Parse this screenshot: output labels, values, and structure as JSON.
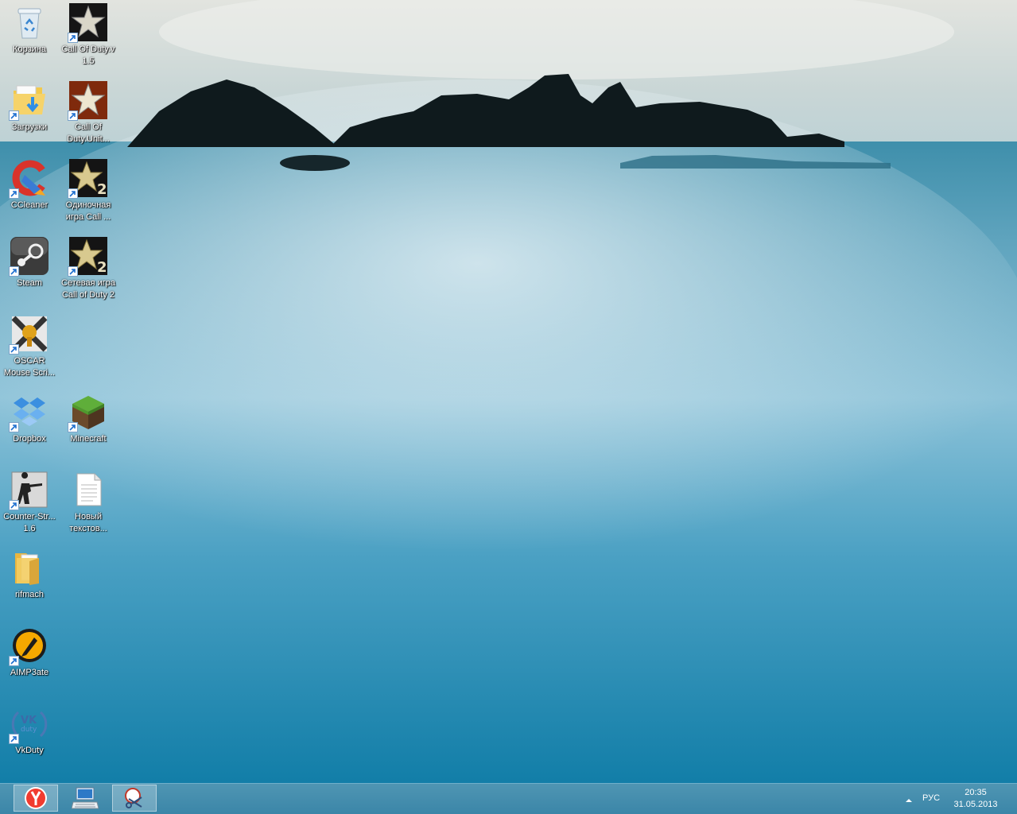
{
  "desktop": {
    "icons": [
      {
        "label": "Корзина",
        "icon": "recycle-bin-icon",
        "shortcut": false
      },
      {
        "label": "Call Of Duty.v 1.5",
        "icon": "call-of-duty-icon",
        "shortcut": true
      },
      {
        "label": "Загрузки",
        "icon": "downloads-folder-icon",
        "shortcut": true
      },
      {
        "label": "Call Of Duty.Unit...",
        "icon": "call-of-duty-united-offensive-icon",
        "shortcut": true
      },
      {
        "label": "CCleaner",
        "icon": "ccleaner-icon",
        "shortcut": true
      },
      {
        "label": "Одиночная игра Call ...",
        "icon": "call-of-duty-2-icon",
        "shortcut": true
      },
      {
        "label": "Steam",
        "icon": "steam-icon",
        "shortcut": true
      },
      {
        "label": "Сетевая игра Call of Duty 2",
        "icon": "call-of-duty-2-icon",
        "shortcut": true
      },
      {
        "label": "OSCAR Mouse Scri...",
        "icon": "oscar-mouse-script-icon",
        "shortcut": true
      },
      {
        "label": "Dropbox",
        "icon": "dropbox-icon",
        "shortcut": true
      },
      {
        "label": "Minecraft",
        "icon": "minecraft-icon",
        "shortcut": true
      },
      {
        "label": "Counter-Str... 1.6",
        "icon": "counter-strike-icon",
        "shortcut": true
      },
      {
        "label": "Новый текстов...",
        "icon": "text-document-icon",
        "shortcut": false
      },
      {
        "label": "rifmach",
        "icon": "folder-icon",
        "shortcut": false
      },
      {
        "label": "AIMP3ate",
        "icon": "aimp-icon",
        "shortcut": true
      },
      {
        "label": "VkDuty",
        "icon": "vkduty-icon",
        "shortcut": true
      }
    ]
  },
  "taskbar": {
    "buttons": [
      {
        "name": "yandex-browser",
        "icon": "yandex-browser-icon",
        "active": true
      },
      {
        "name": "on-screen-keyboard",
        "icon": "computer-keyboard-icon",
        "active": false
      },
      {
        "name": "snipping-tool",
        "icon": "snipping-tool-icon",
        "active": true
      }
    ],
    "tray": {
      "language": "РУС",
      "time": "20:35",
      "date": "31.05.2013"
    }
  }
}
